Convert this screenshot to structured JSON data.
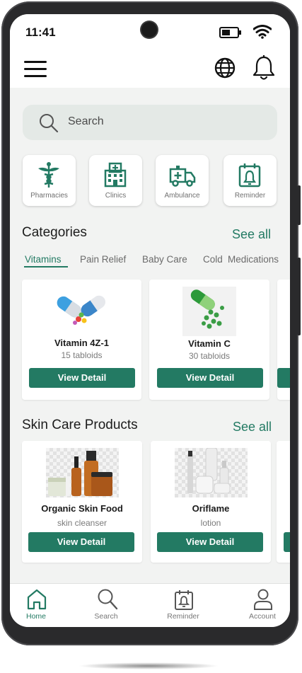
{
  "status_bar": {
    "time": "11:41"
  },
  "header": {
    "menu_icon": "hamburger-menu-icon",
    "language_icon": "globe-icon",
    "notification_icon": "bell-icon"
  },
  "search": {
    "placeholder": "Search",
    "icon": "search-icon"
  },
  "quick_actions": [
    {
      "label": "Pharmacies",
      "icon": "caduceus-icon"
    },
    {
      "label": "Clinics",
      "icon": "hospital-icon"
    },
    {
      "label": "Ambulance",
      "icon": "ambulance-icon"
    },
    {
      "label": "Reminder",
      "icon": "calendar-bell-icon"
    }
  ],
  "categories": {
    "title": "Categories",
    "see_all": "See all",
    "tabs": [
      "Vitamins",
      "Pain Relief",
      "Baby Care",
      "Cold",
      "Medications"
    ],
    "active_tab": "Vitamins",
    "products": [
      {
        "name": "Vitamin 4Z-1",
        "detail": "15 tabloids",
        "button": "View Detail",
        "image": "colorful-capsules-image"
      },
      {
        "name": "Vitamin C",
        "detail": "30 tabloids",
        "button": "View Detail",
        "image": "green-capsule-pills-image"
      }
    ]
  },
  "skin_care": {
    "title": "Skin Care Products",
    "see_all": "See all",
    "products": [
      {
        "name": "Organic Skin Food",
        "detail": "skin cleanser",
        "button": "View Detail",
        "image": "amber-bottles-image"
      },
      {
        "name": "Oriflame",
        "detail": "lotion",
        "button": "View Detail",
        "image": "white-cosmetic-bottles-image"
      }
    ]
  },
  "bottom_nav": [
    {
      "label": "Home",
      "icon": "home-icon",
      "active": true
    },
    {
      "label": "Search",
      "icon": "search-icon",
      "active": false
    },
    {
      "label": "Reminder",
      "icon": "calendar-reminder-icon",
      "active": false
    },
    {
      "label": "Account",
      "icon": "user-icon",
      "active": false
    }
  ],
  "colors": {
    "accent": "#237a63",
    "background": "#f2f3f2",
    "search_bg": "#e4e9e6"
  }
}
